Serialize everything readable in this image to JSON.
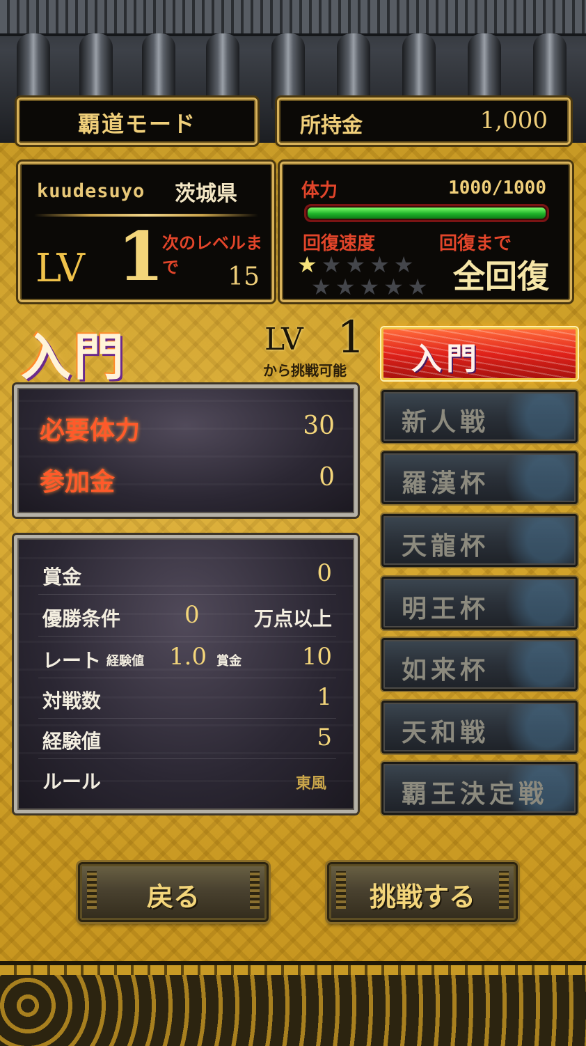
{
  "header": {
    "mode_title": "覇道モード",
    "money_label": "所持金",
    "money_value": "1,000"
  },
  "profile": {
    "username": "kuudesuyo",
    "prefecture": "茨城県",
    "lv_label": "LV",
    "level": "1",
    "next_label": "次のレベルまで",
    "next_value": "15"
  },
  "stamina": {
    "label": "体力",
    "value": "1000/1000",
    "fraction": 1.0,
    "recovery_speed_label": "回復速度",
    "recovery_until_label": "回復まで",
    "stars_total": 10,
    "stars_filled": 1,
    "recovery_status": "全回復"
  },
  "rank": {
    "title": "入門",
    "req_lv_label": "LV",
    "req_lv_value": "1",
    "req_note": "から挑戦可能"
  },
  "requirements": {
    "stamina_label": "必要体力",
    "stamina_value": "30",
    "fee_label": "参加金",
    "fee_value": "0"
  },
  "info": {
    "prize_label": "賞金",
    "prize_value": "0",
    "win_label": "優勝条件",
    "win_value": "0",
    "win_suffix": "万点以上",
    "rate_label": "レート",
    "rate_exp_label": "経験値",
    "rate_exp_value": "1.0",
    "rate_prize_label": "賞金",
    "rate_prize_value": "10",
    "matches_label": "対戦数",
    "matches_value": "1",
    "exp_label": "経験値",
    "exp_value": "5",
    "rule_label": "ルール",
    "rule_value": "東風"
  },
  "rank_buttons": [
    {
      "label": "入門",
      "active": true
    },
    {
      "label": "新人戦",
      "active": false
    },
    {
      "label": "羅漢杯",
      "active": false
    },
    {
      "label": "天龍杯",
      "active": false
    },
    {
      "label": "明王杯",
      "active": false
    },
    {
      "label": "如来杯",
      "active": false
    },
    {
      "label": "天和戦",
      "active": false
    },
    {
      "label": "覇王決定戦",
      "active": false
    }
  ],
  "actions": {
    "back_label": "戻る",
    "challenge_label": "挑戦する"
  },
  "colors": {
    "gold_bg": "#c89a25",
    "accent_red": "#e2452a",
    "text_gold": "#f0cf7a",
    "stamina_green": "#1fb42a"
  }
}
